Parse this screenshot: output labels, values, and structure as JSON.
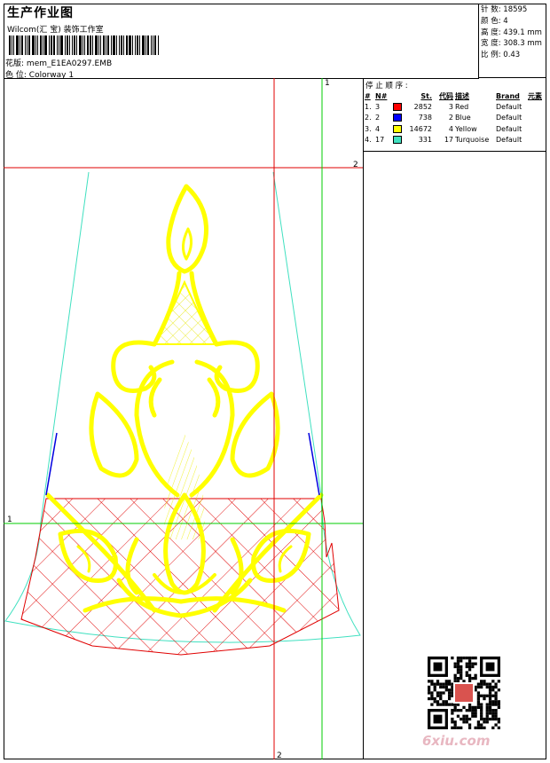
{
  "header": {
    "title": "生产作业图",
    "company": "Wilcom(汇 宝) 装饰工作室",
    "file_label": "花版:",
    "file_value": "mem_E1EA0297.EMB",
    "colorway_label": "色 位:",
    "colorway_value": "Colorway 1"
  },
  "stats": [
    {
      "label": "针 数:",
      "value": "18595"
    },
    {
      "label": "颜 色:",
      "value": "4"
    },
    {
      "label": "高 度:",
      "value": "439.1 mm"
    },
    {
      "label": "宽 度:",
      "value": "308.3 mm"
    },
    {
      "label": "比 例:",
      "value": "0.43"
    }
  ],
  "stop_sequence": {
    "title": "停 止 顺 序 :",
    "columns": [
      "#",
      "N#",
      "",
      "St.",
      "代码",
      "描述",
      "Brand",
      "元素"
    ],
    "rows": [
      {
        "idx": "1.",
        "n": "3",
        "color": "#ff0000",
        "st": "2852",
        "code": "3",
        "desc": "Red",
        "brand": "Default"
      },
      {
        "idx": "2.",
        "n": "2",
        "color": "#0000ff",
        "st": "738",
        "code": "2",
        "desc": "Blue",
        "brand": "Default"
      },
      {
        "idx": "3.",
        "n": "4",
        "color": "#ffff00",
        "st": "14672",
        "code": "4",
        "desc": "Yellow",
        "brand": "Default"
      },
      {
        "idx": "4.",
        "n": "17",
        "color": "#40e0c0",
        "st": "331",
        "code": "17",
        "desc": "Turquoise",
        "brand": "Default"
      }
    ]
  },
  "guides": {
    "h_top": "2",
    "h_green": "1",
    "v_red": "2",
    "v_green": "1"
  },
  "colors": {
    "red": "#e00000",
    "blue": "#0000e0",
    "yellow": "#ffff00",
    "turquoise": "#40e0c0",
    "guide_red": "#e00000",
    "guide_green": "#00cc00"
  },
  "watermark": {
    "brand": "6xiu.com",
    "seal_icon": "qr-code-icon"
  }
}
